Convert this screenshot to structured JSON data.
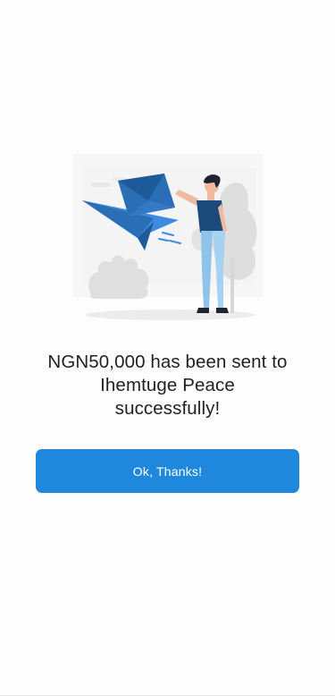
{
  "illustration": {
    "icon": "person-sending-envelope-illustration",
    "accent_color": "#2a6fb5",
    "secondary_color": "#3c8be0"
  },
  "message": {
    "line1": "NGN50,000 has been sent to",
    "line2": "Ihemtuge Peace",
    "line3": "successfully!"
  },
  "button": {
    "label": "Ok, Thanks!",
    "color": "#1f88dd"
  }
}
